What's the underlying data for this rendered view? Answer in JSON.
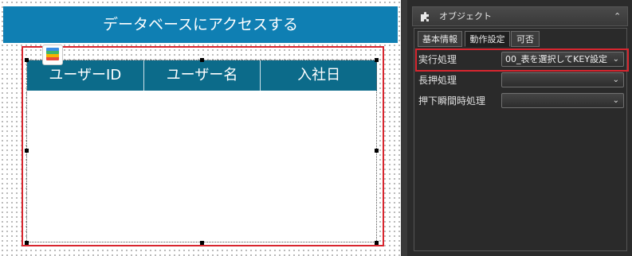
{
  "canvas": {
    "header_title": "データベースにアクセスする",
    "table_columns": [
      "ユーザーID",
      "ユーザー名",
      "入社日"
    ]
  },
  "panel": {
    "title": "オブジェクト",
    "collapse_glyph": "⌃",
    "tabs": [
      "基本情報",
      "動作設定",
      "可否"
    ],
    "active_tab": "動作設定",
    "rows": [
      {
        "label": "実行処理",
        "value": "00_表を選択してKEY設定"
      },
      {
        "label": "長押処理",
        "value": ""
      },
      {
        "label": "押下瞬間時処理",
        "value": ""
      }
    ],
    "dropdown_glyph": "⌄"
  },
  "colors": {
    "header_blue": "#0f7fb3",
    "table_header": "#0c6b8a",
    "highlight_red": "#d8262f",
    "panel_bg": "#2b2b2b"
  }
}
